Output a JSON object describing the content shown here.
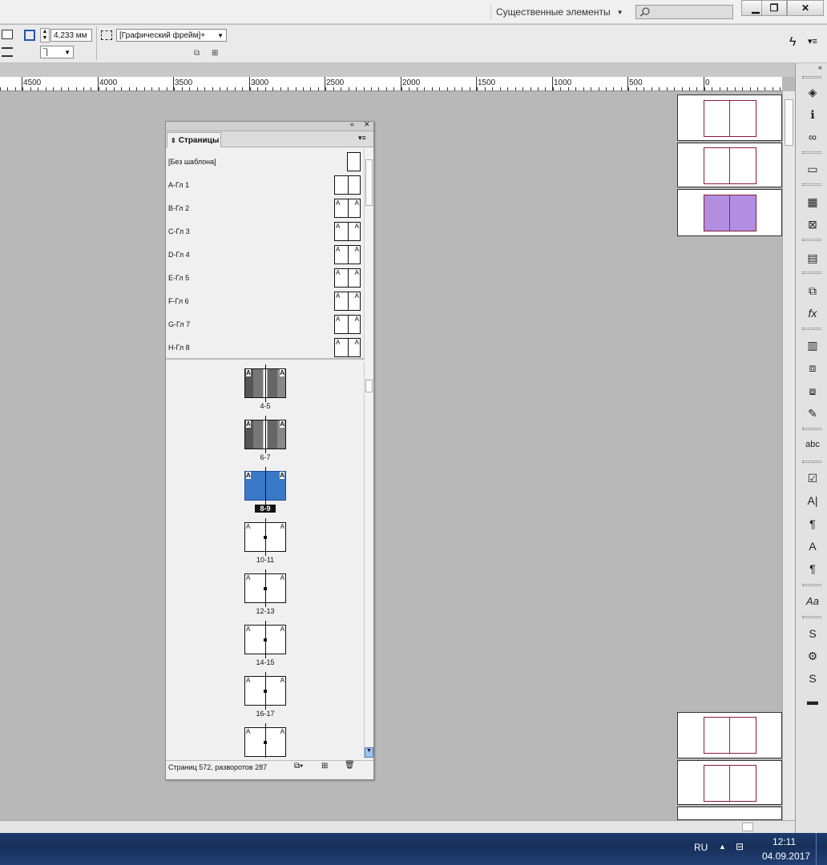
{
  "titlebar": {
    "workspace": "Существенные элементы",
    "window_buttons": [
      "minimize-icon",
      "restore-icon",
      "close-icon"
    ]
  },
  "control": {
    "stroke_weight": "4,233 мм",
    "object_style": "[Графический фрейм]+"
  },
  "ruler": {
    "labels": [
      "4500",
      "4000",
      "3500",
      "3000",
      "2500",
      "2000",
      "1500",
      "1000",
      "500",
      "0"
    ]
  },
  "pages_panel": {
    "tab_label": "Страницы",
    "masters": [
      "[Без шаблона]",
      "A-Гл 1",
      "B-Гл 2",
      "C-Гл 3",
      "D-Гл 4",
      "E-Гл 5",
      "F-Гл 6",
      "G-Гл 7",
      "H-Гл 8"
    ],
    "master_prefix": "A",
    "spreads": [
      {
        "label": "4-5",
        "kind": "content"
      },
      {
        "label": "6-7",
        "kind": "content"
      },
      {
        "label": "8-9",
        "kind": "selected"
      },
      {
        "label": "10-11",
        "kind": "blank"
      },
      {
        "label": "12-13",
        "kind": "blank"
      },
      {
        "label": "14-15",
        "kind": "blank"
      },
      {
        "label": "16-17",
        "kind": "blank"
      },
      {
        "label": "",
        "kind": "blank"
      }
    ],
    "status": "Страниц 572, разворотов 287"
  },
  "taskbar": {
    "language": "RU",
    "time": "12:11",
    "date": "04.09.2017"
  },
  "colors": {
    "selection": "#3a78c8",
    "page_border": "#8a1a3a",
    "taskbar": "#1d3c6e"
  }
}
